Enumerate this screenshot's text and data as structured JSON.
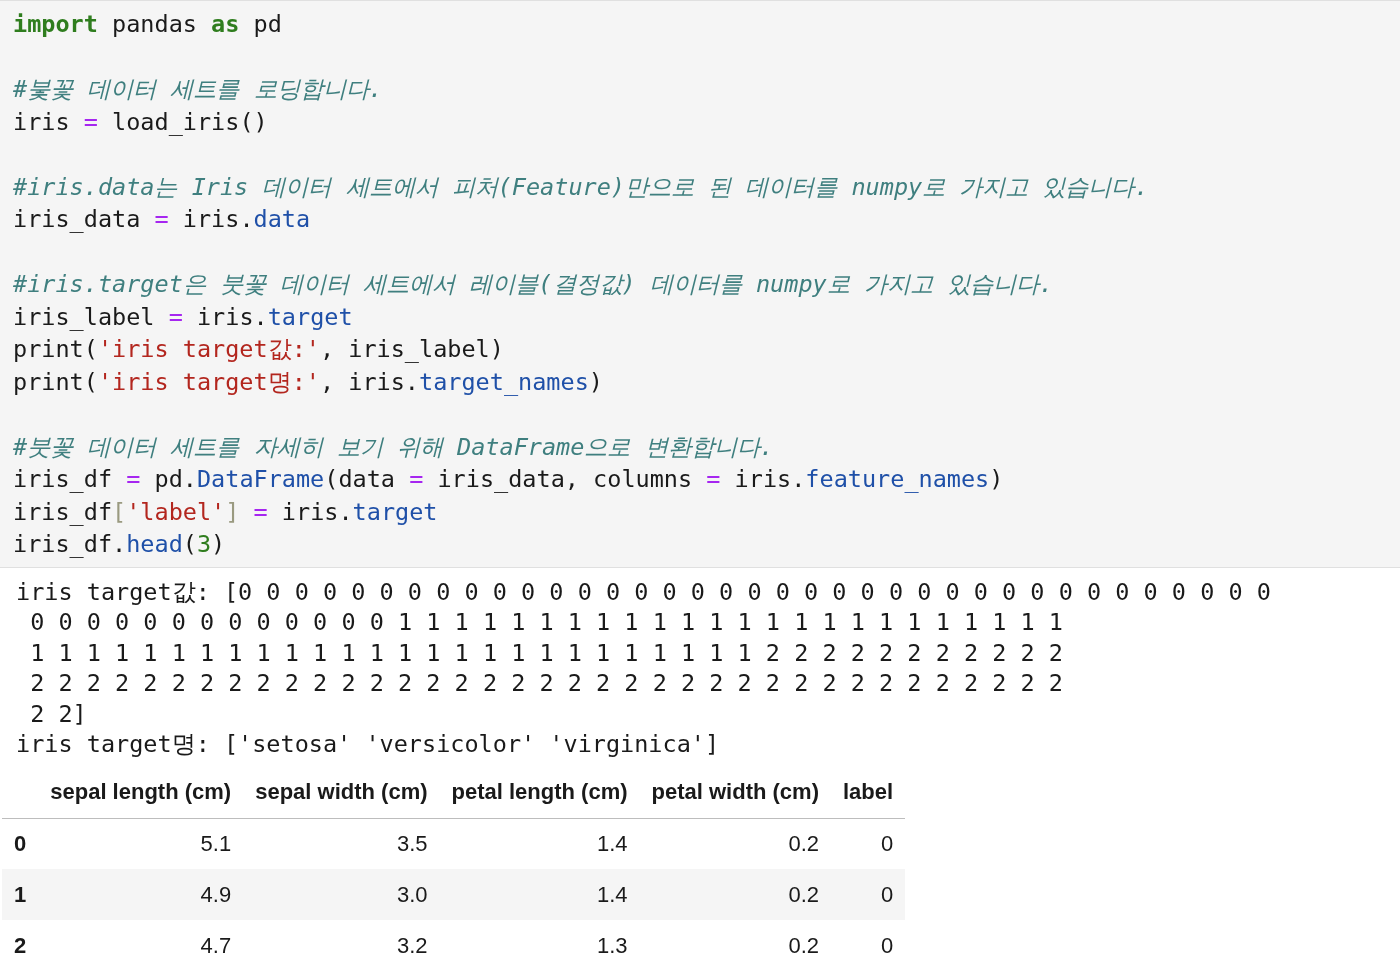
{
  "code_cell": {
    "blocks": [
      [
        [
          {
            "kind": "keyword",
            "text": "import"
          },
          {
            "kind": "plain",
            "text": " pandas "
          },
          {
            "kind": "keyword",
            "text": "as"
          },
          {
            "kind": "plain",
            "text": " pd"
          }
        ]
      ],
      [
        [
          {
            "kind": "comment",
            "text": "#붗꽃 데이터 세트를 로딩합니다."
          }
        ],
        [
          {
            "kind": "plain",
            "text": "iris "
          },
          {
            "kind": "operator",
            "text": "="
          },
          {
            "kind": "plain",
            "text": " load_iris()"
          }
        ]
      ],
      [
        [
          {
            "kind": "comment",
            "text": "#iris.data는 Iris 데이터 세트에서 피처(Feature)만으로 된 데이터를 numpy로 가지고 있습니다."
          }
        ],
        [
          {
            "kind": "plain",
            "text": "iris_data "
          },
          {
            "kind": "operator",
            "text": "="
          },
          {
            "kind": "plain",
            "text": " iris."
          },
          {
            "kind": "attr",
            "text": "data"
          }
        ]
      ],
      [
        [
          {
            "kind": "comment",
            "text": "#iris.target은 붓꽃 데이터 세트에서 레이블(결정값) 데이터를 numpy로 가지고 있습니다."
          }
        ],
        [
          {
            "kind": "plain",
            "text": "iris_label "
          },
          {
            "kind": "operator",
            "text": "="
          },
          {
            "kind": "plain",
            "text": " iris."
          },
          {
            "kind": "attr",
            "text": "target"
          }
        ],
        [
          {
            "kind": "plain",
            "text": "print("
          },
          {
            "kind": "string",
            "text": "'iris target값:'"
          },
          {
            "kind": "plain",
            "text": ", iris_label)"
          }
        ],
        [
          {
            "kind": "plain",
            "text": "print("
          },
          {
            "kind": "string",
            "text": "'iris target명:'"
          },
          {
            "kind": "plain",
            "text": ", iris."
          },
          {
            "kind": "attr",
            "text": "target_names"
          },
          {
            "kind": "plain",
            "text": ")"
          }
        ]
      ],
      [
        [
          {
            "kind": "comment",
            "text": "#붓꽃 데이터 세트를 자세히 보기 위해 DataFrame으로 변환합니다."
          }
        ],
        [
          {
            "kind": "plain",
            "text": "iris_df "
          },
          {
            "kind": "operator",
            "text": "="
          },
          {
            "kind": "plain",
            "text": " pd."
          },
          {
            "kind": "attr",
            "text": "DataFrame"
          },
          {
            "kind": "plain",
            "text": "(data "
          },
          {
            "kind": "operator",
            "text": "="
          },
          {
            "kind": "plain",
            "text": " iris_data, columns "
          },
          {
            "kind": "operator",
            "text": "="
          },
          {
            "kind": "plain",
            "text": " iris."
          },
          {
            "kind": "attr",
            "text": "feature_names"
          },
          {
            "kind": "plain",
            "text": ")"
          }
        ],
        [
          {
            "kind": "plain",
            "text": "iris_df"
          },
          {
            "kind": "punct",
            "text": "["
          },
          {
            "kind": "string",
            "text": "'label'"
          },
          {
            "kind": "punct",
            "text": "]"
          },
          {
            "kind": "operator",
            "text": " ="
          },
          {
            "kind": "plain",
            "text": " iris."
          },
          {
            "kind": "attr",
            "text": "target"
          }
        ],
        [
          {
            "kind": "plain",
            "text": "iris_df."
          },
          {
            "kind": "attr",
            "text": "head"
          },
          {
            "kind": "plain",
            "text": "("
          },
          {
            "kind": "number",
            "text": "3"
          },
          {
            "kind": "plain",
            "text": ")"
          }
        ]
      ]
    ]
  },
  "output": {
    "lines": [
      "iris target값: [0 0 0 0 0 0 0 0 0 0 0 0 0 0 0 0 0 0 0 0 0 0 0 0 0 0 0 0 0 0 0 0 0 0 0 0 0",
      " 0 0 0 0 0 0 0 0 0 0 0 0 0 1 1 1 1 1 1 1 1 1 1 1 1 1 1 1 1 1 1 1 1 1 1 1 1",
      " 1 1 1 1 1 1 1 1 1 1 1 1 1 1 1 1 1 1 1 1 1 1 1 1 1 1 2 2 2 2 2 2 2 2 2 2 2",
      " 2 2 2 2 2 2 2 2 2 2 2 2 2 2 2 2 2 2 2 2 2 2 2 2 2 2 2 2 2 2 2 2 2 2 2 2 2",
      " 2 2]",
      "iris target명: ['setosa' 'versicolor' 'virginica']"
    ]
  },
  "table": {
    "columns": [
      "sepal length (cm)",
      "sepal width (cm)",
      "petal length (cm)",
      "petal width (cm)",
      "label"
    ],
    "rows": [
      {
        "index": "0",
        "cells": [
          "5.1",
          "3.5",
          "1.4",
          "0.2",
          "0"
        ]
      },
      {
        "index": "1",
        "cells": [
          "4.9",
          "3.0",
          "1.4",
          "0.2",
          "0"
        ]
      },
      {
        "index": "2",
        "cells": [
          "4.7",
          "3.2",
          "1.3",
          "0.2",
          "0"
        ]
      }
    ]
  }
}
